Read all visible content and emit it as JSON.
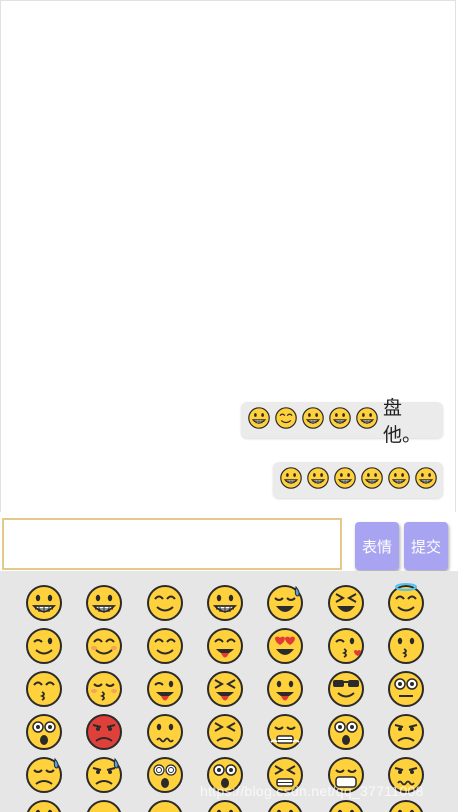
{
  "messages": [
    {
      "emojis": [
        "grin",
        "smile",
        "grin",
        "grin",
        "grin"
      ],
      "text": "盘他。"
    },
    {
      "emojis": [
        "grin",
        "grin",
        "grin",
        "grin",
        "grin",
        "grin"
      ],
      "text": ""
    }
  ],
  "composer": {
    "input_value": "",
    "emoji_label": "表情",
    "submit_label": "提交"
  },
  "emoji_panel": [
    [
      "grin",
      "grin",
      "smile",
      "grin",
      "sweat",
      "laugh",
      "halo"
    ],
    [
      "wink",
      "blush",
      "smile",
      "yum",
      "heart-eyes",
      "kiss-heart",
      "kiss"
    ],
    [
      "kiss-smile",
      "kiss-blush",
      "tongue-wink",
      "tongue-squint",
      "tongue",
      "sunglasses",
      "eye-roll"
    ],
    [
      "shocked",
      "angry",
      "confused",
      "persevere",
      "steam",
      "astonished",
      "disappointed"
    ],
    [
      "sad-sweat",
      "sweat-sad",
      "dizzy",
      "scream",
      "tired",
      "mask",
      "worried"
    ],
    [
      "partial",
      "sleepy",
      "zzz",
      "partial",
      "partial",
      "partial",
      "partial"
    ]
  ],
  "watermark": "https://blog.csdn.net/qq_37711008",
  "colors": {
    "emoji_yellow": "#ffd13d",
    "outline": "#2b2b2b",
    "button": "#a9a4f1",
    "panel_bg": "#e6e6e6",
    "bubble_bg": "#ebebeb",
    "input_border": "#e5c98a"
  }
}
